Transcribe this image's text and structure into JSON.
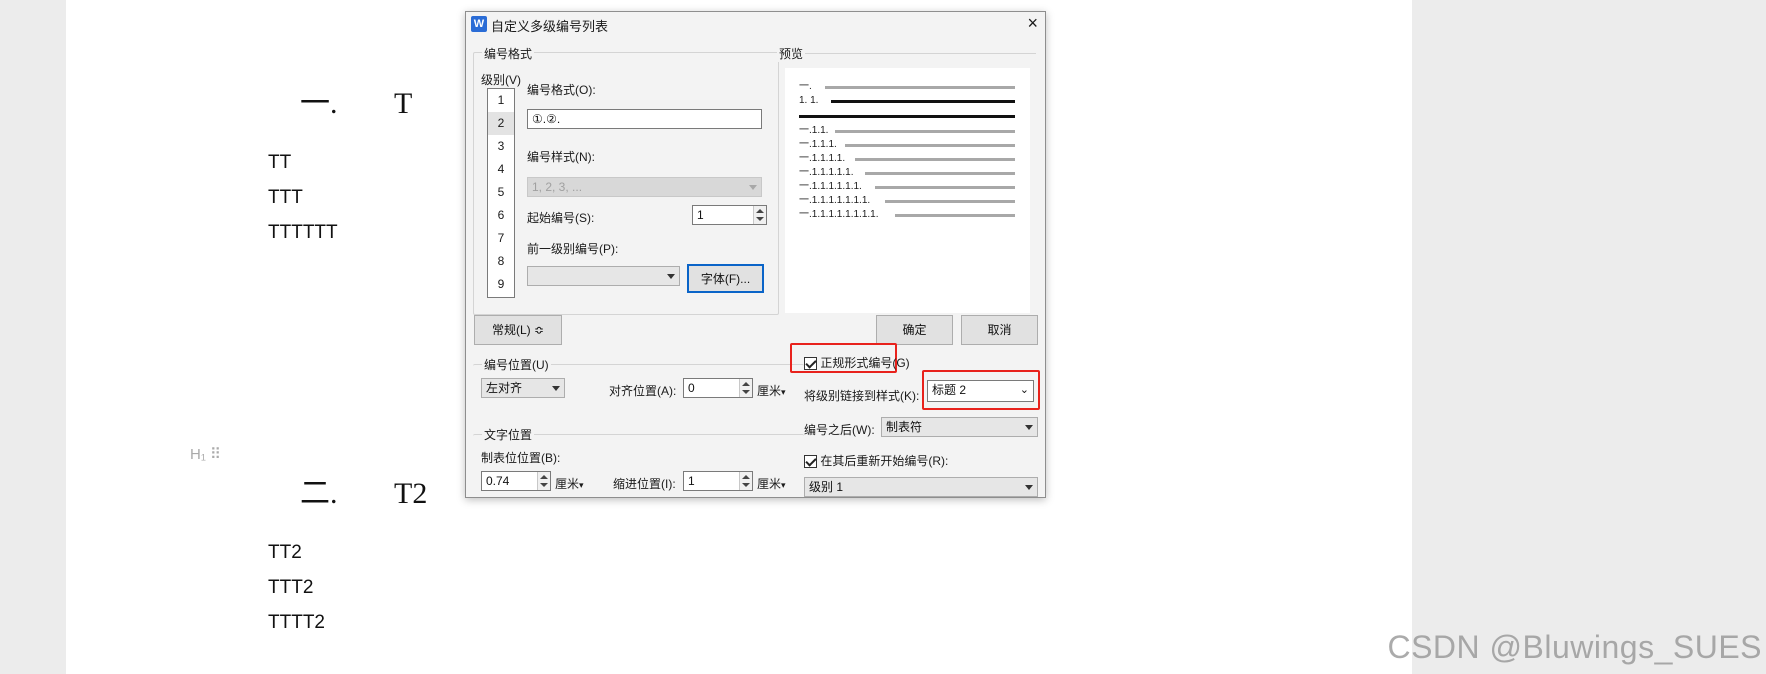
{
  "document": {
    "heading1": {
      "number": "一.",
      "text": "T"
    },
    "paragraphs1": [
      "TT",
      "TTT",
      "TTTTTT"
    ],
    "heading2": {
      "number": "二.",
      "text": "T2"
    },
    "paragraphs2": [
      "TT2",
      "TTT2",
      "TTTT2"
    ],
    "gutter_marker": "H₁ ⠿"
  },
  "watermark": "CSDN @Bluwings_SUES",
  "dialog": {
    "app_icon": "W",
    "title": "自定义多级编号列表",
    "close_icon": "×",
    "number_format_group": "编号格式",
    "level_label": "级别(V)",
    "levels": [
      "1",
      "2",
      "3",
      "4",
      "5",
      "6",
      "7",
      "8",
      "9"
    ],
    "selected_level": "2",
    "format_label": "编号格式(O):",
    "format_value": "①.②.",
    "style_label": "编号样式(N):",
    "style_value": "1, 2, 3, ...",
    "start_label": "起始编号(S):",
    "start_value": "1",
    "prev_level_label": "前一级别编号(P):",
    "prev_level_value": "",
    "font_button": "字体(F)...",
    "preview_label": "预览",
    "preview_rows": [
      "一.",
      "1. 1.",
      "",
      "一.1.1.",
      "一.1.1.1.",
      "一.1.1.1.1.",
      "一.1.1.1.1.1.",
      "一.1.1.1.1.1.1.",
      "一.1.1.1.1.1.1.1.",
      "一.1.1.1.1.1.1.1.1."
    ],
    "general_button": "常规(L)",
    "general_icon": "≎",
    "ok_button": "确定",
    "cancel_button": "取消",
    "number_position_label": "编号位置(U)",
    "align_value": "左对齐",
    "align_pos_label": "对齐位置(A):",
    "align_pos_value": "0",
    "unit": "厘米",
    "legal_numbering_label": "正规形式编号(G)",
    "legal_numbering_checked": true,
    "link_style_label": "将级别链接到样式(K):",
    "link_style_value": "标题 2",
    "text_position_label": "文字位置",
    "tab_pos_label": "制表位位置(B):",
    "tab_pos_value": "0.74",
    "indent_label": "缩进位置(I):",
    "indent_value": "1",
    "after_number_label": "编号之后(W):",
    "after_number_value": "制表符",
    "restart_label": "在其后重新开始编号(R):",
    "restart_checked": true,
    "restart_value": "级别 1"
  },
  "colors": {
    "highlight_red": "#e8221c",
    "focus_blue": "#0a64c8"
  }
}
